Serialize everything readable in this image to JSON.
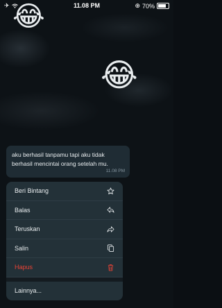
{
  "status_bar": {
    "time": "11.08 PM",
    "battery": "70%"
  },
  "emojis": {
    "top": "😂",
    "middle": "😂"
  },
  "message": {
    "text": "aku berhasil tanpamu tapi aku tidak berhasil mencintai orang setelah mu.",
    "time": "11.08 PM"
  },
  "menu": {
    "items": [
      {
        "label": "Beri Bintang",
        "icon": "star-icon"
      },
      {
        "label": "Balas",
        "icon": "reply-icon"
      },
      {
        "label": "Teruskan",
        "icon": "forward-icon"
      },
      {
        "label": "Salin",
        "icon": "copy-icon"
      },
      {
        "label": "Hapus",
        "icon": "trash-icon"
      }
    ],
    "more": {
      "label": "Lainnya..."
    },
    "colors": {
      "danger": "#ea4335",
      "background": "#233138"
    }
  }
}
